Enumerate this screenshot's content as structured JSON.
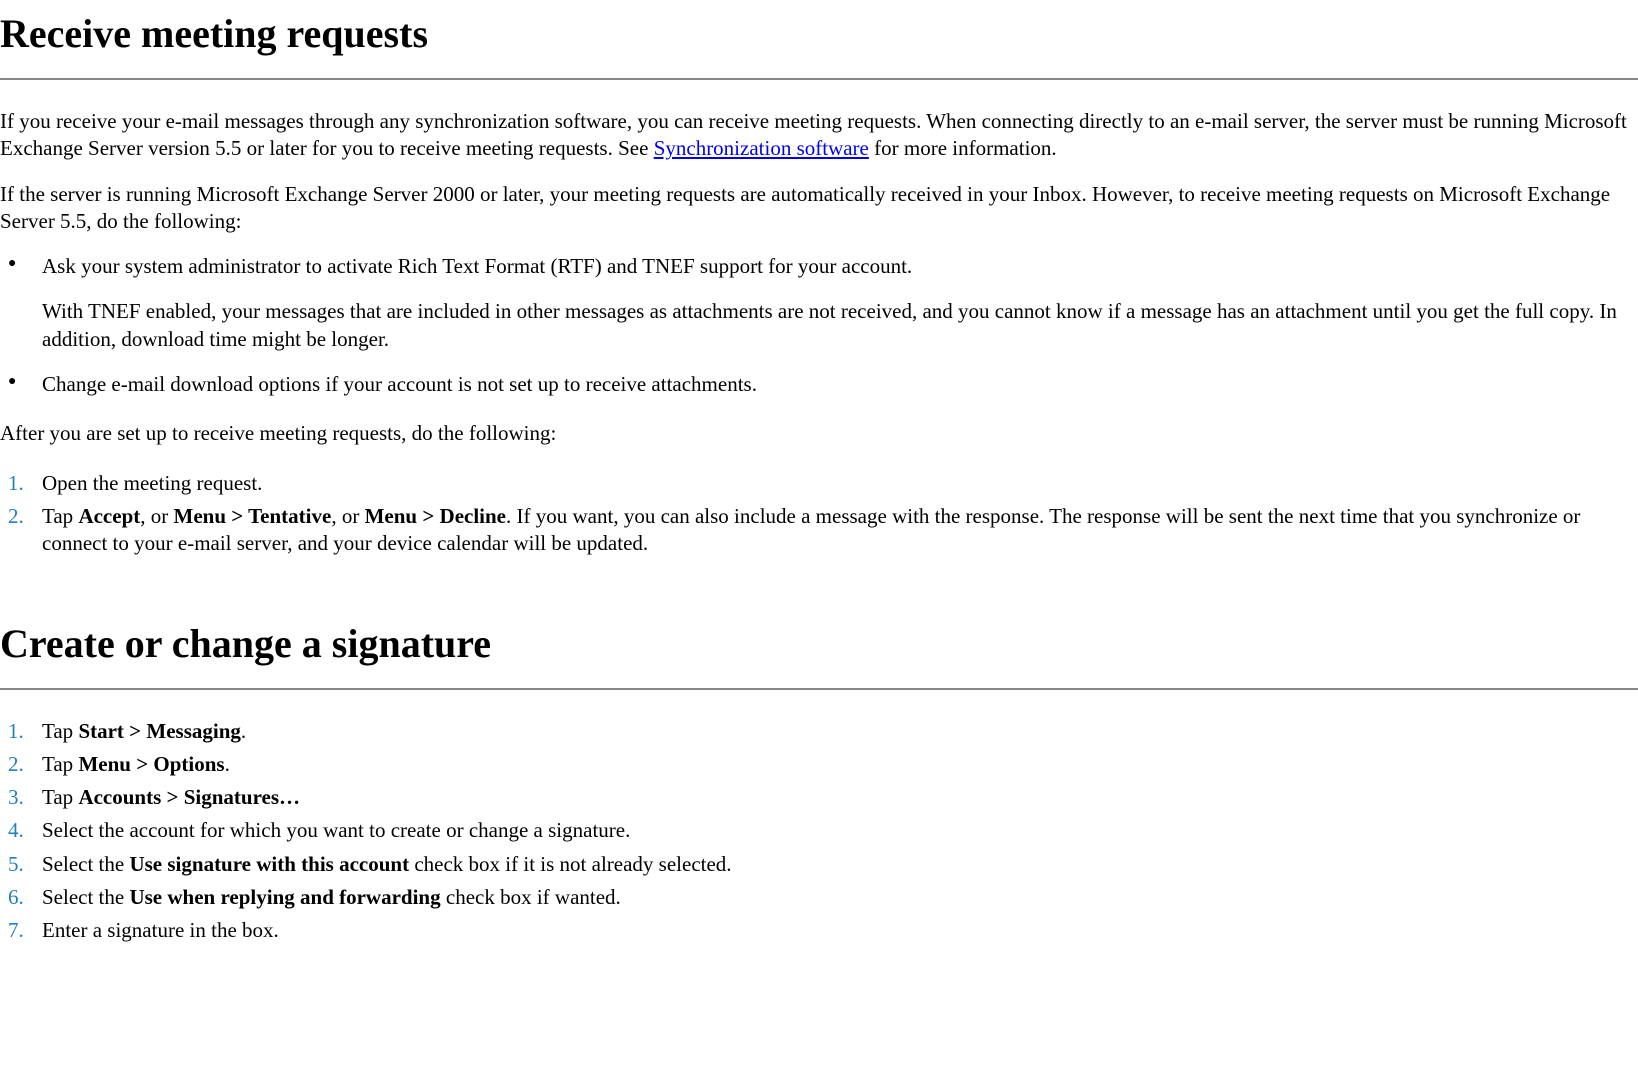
{
  "section1": {
    "title": "Receive meeting requests",
    "intro_part1": "If you receive your e-mail messages through any synchronization software, you can receive meeting requests. When connecting directly to an e-mail server, the server must be running Microsoft Exchange Server version 5.5 or later for you to receive meeting requests. See ",
    "link_text": "Synchronization software",
    "intro_part2": " for more information.",
    "para2": "If the server is running Microsoft Exchange Server 2000 or later, your meeting requests are automatically received in your Inbox. However, to receive meeting requests on Microsoft Exchange Server 5.5, do the following:",
    "bullet1_line1": "Ask your system administrator to activate Rich Text Format (RTF) and TNEF support for your account.",
    "bullet1_line2": "With TNEF enabled, your messages that are included in other messages as attachments are not received, and you cannot know if a message has an attachment until you get the full copy. In addition, download time might be longer.",
    "bullet2": "Change e-mail download options if your account is not set up to receive attachments.",
    "after_setup": "After you are set up to receive meeting requests, do the following:",
    "step1": "Open the meeting request.",
    "step2_part1": "Tap ",
    "step2_bold1": "Accept",
    "step2_part2": ", or ",
    "step2_bold2": "Menu > Tentative",
    "step2_part3": ", or ",
    "step2_bold3": "Menu > Decline",
    "step2_part4": ". If you want, you can also include a message with the response. The response will be sent the next time that you synchronize or connect to your e-mail server, and your device calendar will be updated."
  },
  "section2": {
    "title": "Create or change a signature",
    "step1_part1": "Tap ",
    "step1_bold": "Start > Messaging",
    "step1_part2": ".",
    "step2_part1": "Tap ",
    "step2_bold": "Menu > Options",
    "step2_part2": ".",
    "step3_part1": "Tap ",
    "step3_bold": "Accounts > Signatures…",
    "step4": "Select the account for which you want to create or change a signature.",
    "step5_part1": "Select the ",
    "step5_bold": "Use signature with this account",
    "step5_part2": " check box if it is not already selected.",
    "step6_part1": "Select the ",
    "step6_bold": "Use when replying and forwarding",
    "step6_part2": " check box if wanted.",
    "step7": "Enter a signature in the box."
  }
}
